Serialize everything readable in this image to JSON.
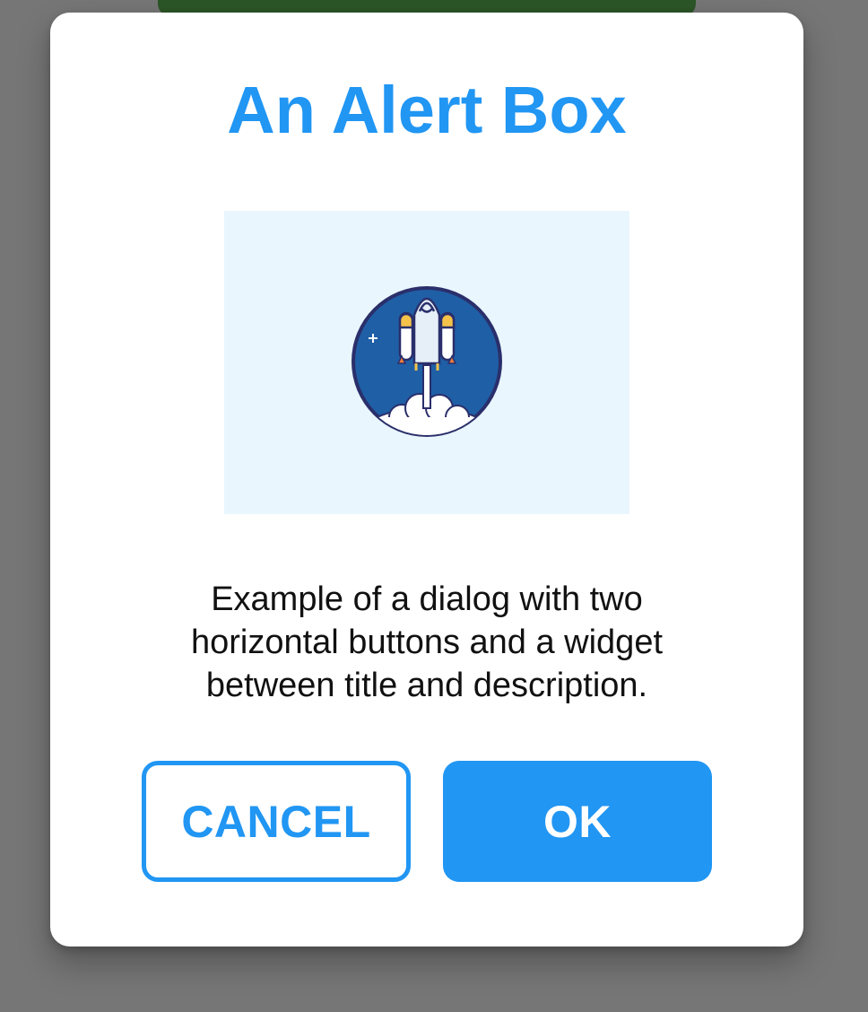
{
  "dialog": {
    "title": "An Alert Box",
    "description": "Example of a dialog with two horizontal buttons and a widget between title and description.",
    "image_icon": "rocket-launch-icon",
    "buttons": {
      "cancel_label": "CANCEL",
      "ok_label": "OK"
    }
  },
  "colors": {
    "accent": "#2196f3",
    "scrim": "#767676",
    "image_background": "#eaf6fd",
    "behind_bar": "#2c5527"
  }
}
